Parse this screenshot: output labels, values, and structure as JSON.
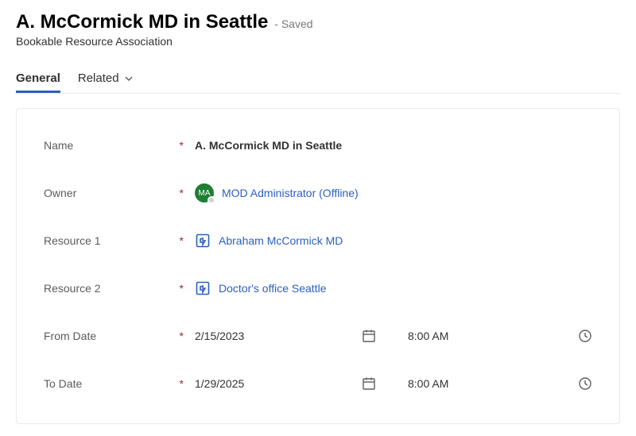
{
  "header": {
    "title": "A. McCormick MD in Seattle",
    "saved_suffix": "- Saved",
    "subtitle": "Bookable Resource Association"
  },
  "tabs": {
    "general": "General",
    "related": "Related"
  },
  "fields": {
    "name": {
      "label": "Name",
      "value": "A. McCormick MD in Seattle"
    },
    "owner": {
      "label": "Owner",
      "avatar_initials": "MA",
      "value": "MOD Administrator (Offline)"
    },
    "resource1": {
      "label": "Resource 1",
      "value": "Abraham McCormick MD"
    },
    "resource2": {
      "label": "Resource 2",
      "value": "Doctor's office Seattle"
    },
    "from": {
      "label": "From Date",
      "date": "2/15/2023",
      "time": "8:00 AM"
    },
    "to": {
      "label": "To Date",
      "date": "1/29/2025",
      "time": "8:00 AM"
    }
  },
  "required_marker": "*"
}
